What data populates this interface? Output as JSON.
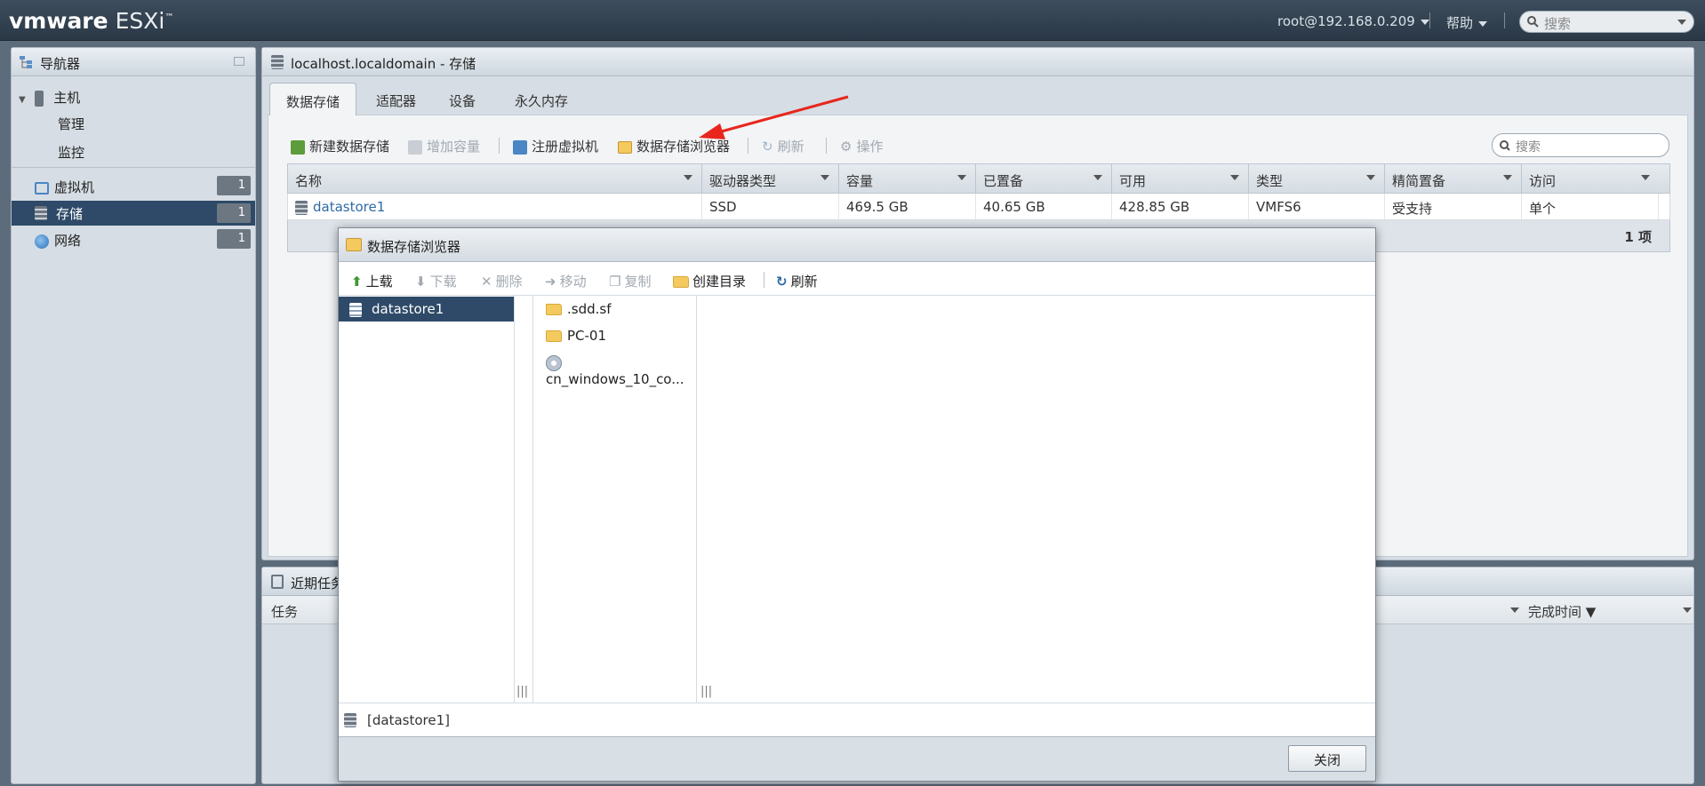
{
  "topbar": {
    "logo_brand": "vmware",
    "logo_product": "ESXi",
    "user": "root@192.168.0.209",
    "help": "帮助",
    "search_placeholder": "搜索"
  },
  "navigator": {
    "title": "导航器",
    "host": "主机",
    "host_children": [
      "管理",
      "监控"
    ],
    "items": [
      {
        "label": "虚拟机",
        "count": "1",
        "icon": "vm-icon"
      },
      {
        "label": "存储",
        "count": "1",
        "icon": "storage-icon",
        "selected": true
      },
      {
        "label": "网络",
        "count": "1",
        "icon": "network-icon"
      }
    ]
  },
  "main": {
    "title": "localhost.localdomain - 存储",
    "tabs": [
      "数据存储",
      "适配器",
      "设备",
      "永久内存"
    ],
    "toolbar": {
      "new_ds": "新建数据存储",
      "increase": "增加容量",
      "register_vm": "注册虚拟机",
      "ds_browser": "数据存储浏览器",
      "refresh": "刷新",
      "actions": "操作",
      "search_placeholder": "搜索"
    },
    "columns": [
      "名称",
      "驱动器类型",
      "容量",
      "已置备",
      "可用",
      "类型",
      "精简置备",
      "访问"
    ],
    "rows": [
      [
        "datastore1",
        "SSD",
        "469.5 GB",
        "40.65 GB",
        "428.85 GB",
        "VMFS6",
        "受支持",
        "单个"
      ]
    ],
    "footer_count": "1 项"
  },
  "tasks": {
    "title": "近期任务",
    "col_task": "任务",
    "col_done": "完成时间 ▼"
  },
  "dialog": {
    "title": "数据存储浏览器",
    "toolbar": {
      "upload": "上载",
      "download": "下载",
      "delete": "删除",
      "move": "移动",
      "copy": "复制",
      "mkdir": "创建目录",
      "refresh": "刷新"
    },
    "datastores": [
      "datastore1"
    ],
    "files": [
      {
        "name": ".sdd.sf",
        "icon": "folder-icon"
      },
      {
        "name": "PC-01",
        "icon": "folder-icon"
      },
      {
        "name": "cn_windows_10_co...",
        "icon": "disc-icon"
      }
    ],
    "path": "[datastore1]",
    "close": "关闭"
  },
  "colors": {
    "topbar": "#2f3e4d",
    "selected": "#2e4a68",
    "annotation_arrow": "#e8261c"
  }
}
